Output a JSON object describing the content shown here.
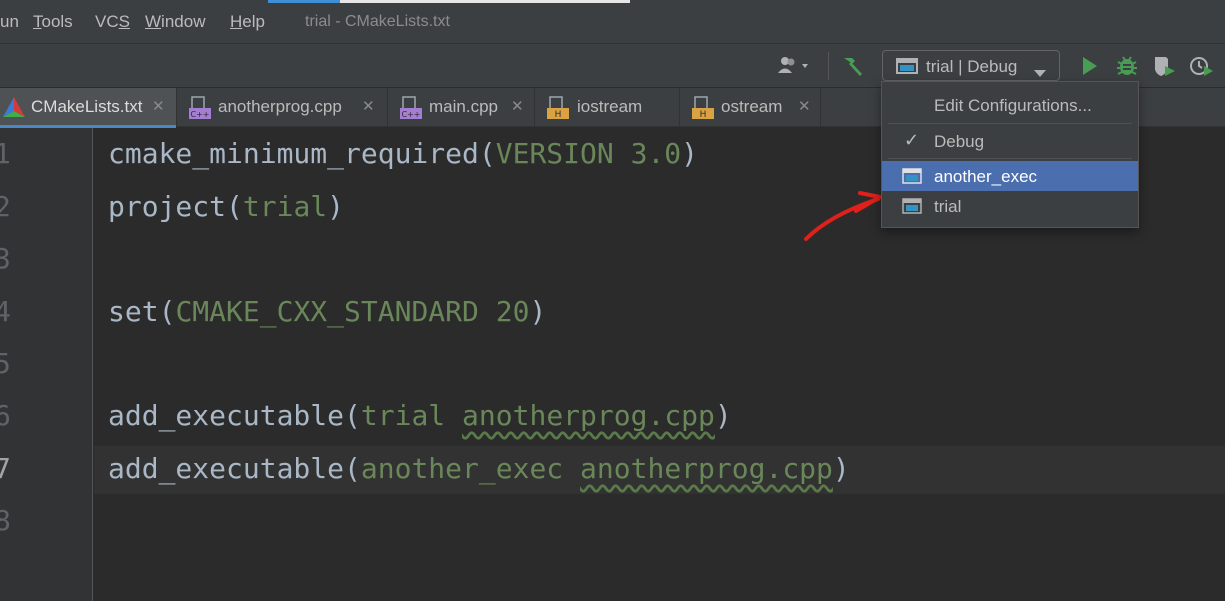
{
  "menubar": {
    "items": [
      {
        "label": "un",
        "underline": false
      },
      {
        "label": "Tools",
        "underline_index": 0
      },
      {
        "label": "VCS",
        "underline_index": 2
      },
      {
        "label": "Window",
        "underline_index": 0
      },
      {
        "label": "Help",
        "underline_index": 0
      }
    ],
    "title": "trial - CMakeLists.txt"
  },
  "toolbar": {
    "config_label": "trial | Debug",
    "icons": [
      "user-icon",
      "build-hammer-icon",
      "run-icon",
      "debug-bug-icon",
      "coverage-icon",
      "profile-icon"
    ]
  },
  "tabs": [
    {
      "label": "CMakeLists.txt",
      "icon": "cmake-icon",
      "active": true
    },
    {
      "label": "anotherprog.cpp",
      "icon": "cpp-file-icon",
      "active": false
    },
    {
      "label": "main.cpp",
      "icon": "cpp-file-icon",
      "active": false
    },
    {
      "label": "iostream",
      "icon": "header-file-icon",
      "active": false
    },
    {
      "label": "ostream",
      "icon": "header-file-icon",
      "active": false
    }
  ],
  "tab_close_glyph": "✕",
  "editor": {
    "line_numbers": [
      "1",
      "2",
      "3",
      "4",
      "5",
      "6",
      "7",
      "8"
    ],
    "current_line": "7",
    "lines": [
      {
        "fn": "cmake_minimum_required",
        "open": "(",
        "args": "VERSION 3.0",
        "close": ")"
      },
      {
        "fn": "project",
        "open": "(",
        "args": "trial",
        "close": ")"
      },
      {
        "fn": "",
        "open": "",
        "args": "",
        "close": ""
      },
      {
        "fn": "set",
        "open": "(",
        "args": "CMAKE_CXX_STANDARD 20",
        "close": ")"
      },
      {
        "fn": "",
        "open": "",
        "args": "",
        "close": ""
      },
      {
        "fn": "add_executable",
        "open": "(",
        "args_a": "trial ",
        "args_b": "anotherprog.cpp",
        "close": ")"
      },
      {
        "fn": "add_executable",
        "open": "(",
        "args_a": "another_exec ",
        "args_b": "anotherprog.cpp",
        "close": ")"
      },
      {
        "fn": "",
        "open": "",
        "args": "",
        "close": ""
      }
    ]
  },
  "popup": {
    "edit_label": "Edit Configurations...",
    "check_glyph": "✓",
    "debug_label": "Debug",
    "targets": [
      {
        "label": "another_exec",
        "selected": true
      },
      {
        "label": "trial",
        "selected": false
      }
    ]
  },
  "colors": {
    "accent": "#4b6eaf",
    "run_green": "#499c54",
    "string_green": "#6a8759",
    "annotation_red": "#e0201a"
  }
}
